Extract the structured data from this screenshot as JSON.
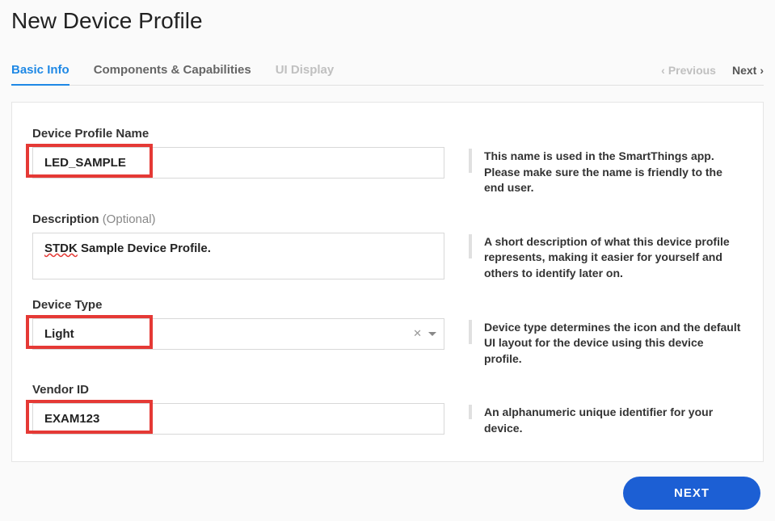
{
  "page": {
    "title": "New Device Profile"
  },
  "tabs": {
    "basic_info": "Basic Info",
    "components": "Components & Capabilities",
    "ui_display": "UI Display"
  },
  "nav": {
    "previous": "Previous",
    "next": "Next"
  },
  "fields": {
    "name": {
      "label": "Device Profile Name",
      "value": "LED_SAMPLE",
      "help": "This name is used in the SmartThings app. Please make sure the name is friendly to the end user."
    },
    "description": {
      "label": "Description",
      "optional": "(Optional)",
      "value_prefix": "STDK",
      "value_rest": " Sample Device Profile.",
      "help": "A short description of what this device profile represents, making it easier for yourself and others to identify later on."
    },
    "device_type": {
      "label": "Device Type",
      "value": "Light",
      "help": "Device type determines the icon and the default UI layout for the device using this device profile."
    },
    "vendor_id": {
      "label": "Vendor ID",
      "value": "EXAM123",
      "help": "An alphanumeric unique identifier for your device."
    }
  },
  "buttons": {
    "next": "NEXT"
  }
}
